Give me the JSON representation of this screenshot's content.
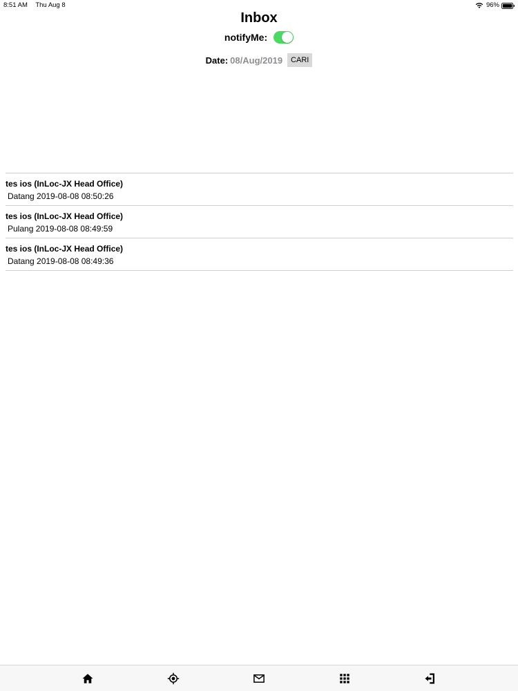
{
  "status_bar": {
    "time": "8:51 AM",
    "date": "Thu Aug 8",
    "battery": "96%",
    "icons": [
      "wifi-icon",
      "battery-icon"
    ]
  },
  "header": {
    "title": "Inbox",
    "notify_label": "notifyMe:",
    "notify_enabled": true,
    "toggle_color": "#4cd964",
    "date_label": "Date:",
    "date_value": "08/Aug/2019",
    "search_label": "CARI"
  },
  "inbox": {
    "items": [
      {
        "title": "tes ios (InLoc-JX Head Office)",
        "subtitle": "Datang 2019-08-08 08:50:26"
      },
      {
        "title": "tes ios (InLoc-JX Head Office)",
        "subtitle": "Pulang 2019-08-08 08:49:59"
      },
      {
        "title": "tes ios (InLoc-JX Head Office)",
        "subtitle": "Datang 2019-08-08 08:49:36"
      }
    ]
  },
  "tab_bar": {
    "tabs": [
      "home-icon",
      "location-target-icon",
      "mail-icon",
      "grid-icon",
      "logout-icon"
    ]
  }
}
